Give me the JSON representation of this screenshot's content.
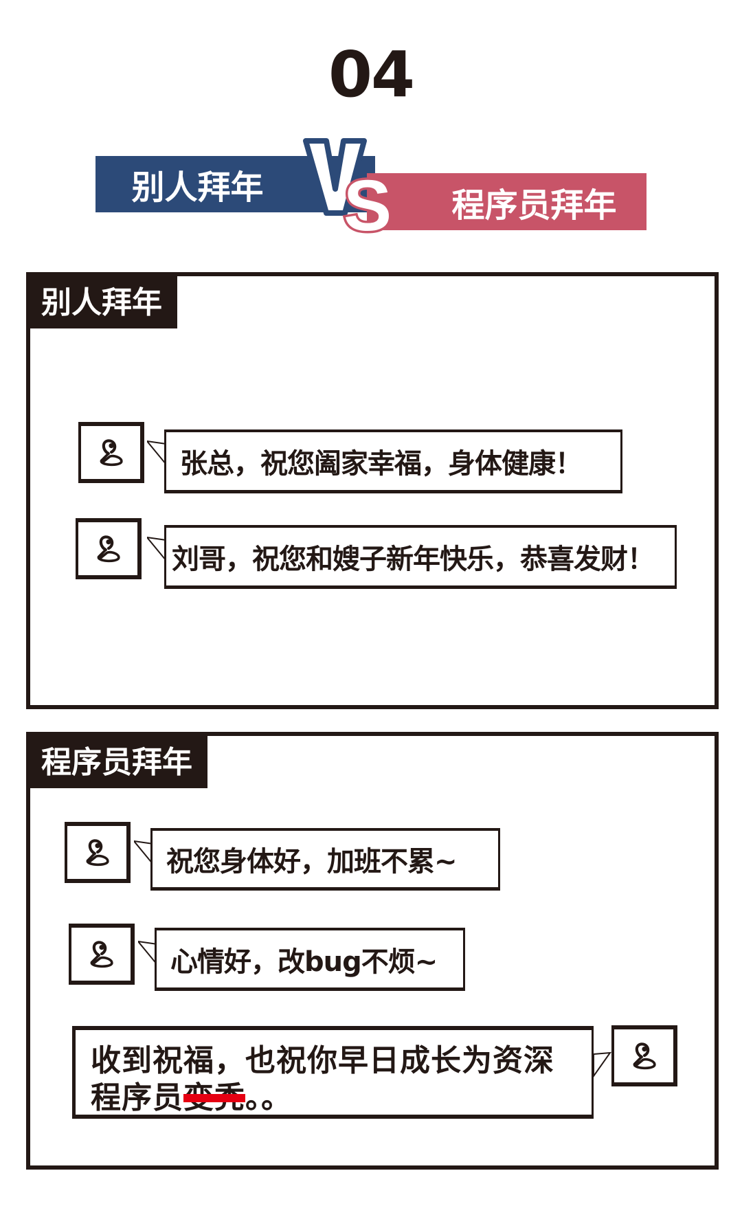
{
  "header": {
    "number": "04",
    "left_label": "别人拜年",
    "right_label": "程序员拜年",
    "vs": "VS"
  },
  "colors": {
    "blue": "#2c4a78",
    "red": "#c85468",
    "ink": "#231815",
    "strike": "#e60012"
  },
  "panel1": {
    "title": "别人拜年",
    "messages": [
      "张总，祝您阖家幸福，身体健康！",
      "刘哥，祝您和嫂子新年快乐，恭喜发财！"
    ]
  },
  "panel2": {
    "title": "程序员拜年",
    "messages": [
      "祝您身体好，加班不累~",
      "心情好，改bug不烦~"
    ],
    "reply": {
      "line1": "收到祝福，也祝你早日成长为资深",
      "line2_prefix": "程序员",
      "line2_struck": "变秃",
      "line2_suffix": "。。"
    }
  }
}
